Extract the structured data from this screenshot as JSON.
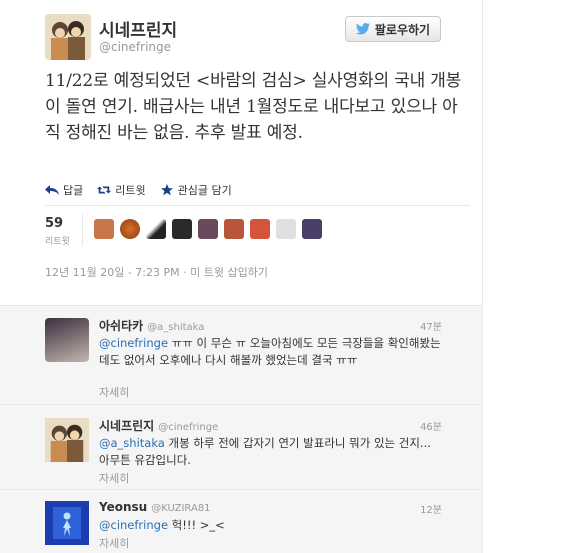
{
  "profile": {
    "display_name": "시네프린지",
    "handle": "@cinefringe",
    "follow_label": "팔로우하기"
  },
  "tweet": {
    "text": "11/22로 예정되었던 <바람의 검심> 실사영화의 국내 개봉이 돌연 연기. 배급사는 내년 1월정도로 내다보고 있으나 아직 정해진 바는 없음. 추후 발표 예정.",
    "actions": {
      "reply": "답글",
      "retweet": "리트윗",
      "favorite": "관심글 담기"
    },
    "retweet_count": "59",
    "retweet_label": "리트윗",
    "timestamp": "12년 11월 20일 - 7:23 PM · 미 트윗 삽입하기"
  },
  "replies": [
    {
      "name": "아쉬타카",
      "handle": "@a_shitaka",
      "time": "47분",
      "mention": "@cinefringe",
      "text": " ㅠㅠ 이 무슨 ㅠ 오늘아침에도 모든 극장들을 확인해봤는데도 없어서 오후에나 다시 해볼까 했었는데 결국 ㅠㅠ",
      "more": "자세히"
    },
    {
      "name": "시네프린지",
      "handle": "@cinefringe",
      "time": "46분",
      "mention": "@a_shitaka",
      "text": " 개봉 하루 전에 갑자기 연기 발표라니 뭐가 있는 건지... 아무튼 유감입니다.",
      "more": "자세히"
    },
    {
      "name": "Yeonsu",
      "handle": "@KUZIRA81",
      "time": "12분",
      "mention": "@cinefringe",
      "text": " 헉!!! >_<",
      "more": "자세히"
    }
  ],
  "colors": {
    "mention": "#2a6fb5",
    "follow_bird": "#55acee",
    "action_icon": "#1d3f8a"
  }
}
